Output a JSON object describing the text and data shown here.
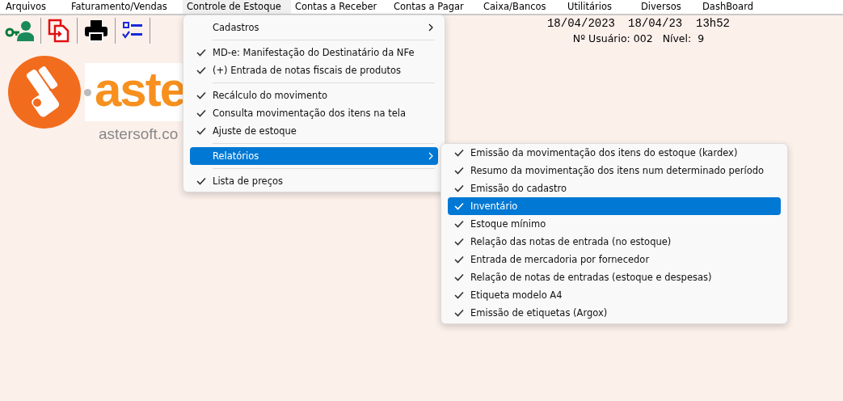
{
  "menu_bar": [
    {
      "label": "Arquivos",
      "selected": false
    },
    {
      "label": "Faturamento/Vendas",
      "selected": false
    },
    {
      "label": "Controle de Estoque",
      "selected": true
    },
    {
      "label": "Contas a Receber",
      "selected": false
    },
    {
      "label": "Contas a Pagar",
      "selected": false
    },
    {
      "label": "Caixa/Bancos",
      "selected": false
    },
    {
      "label": "Utilitários",
      "selected": false
    },
    {
      "label": "Diversos",
      "selected": false
    },
    {
      "label": "DashBoard",
      "selected": false
    }
  ],
  "toolbar": [
    {
      "kind": "user-key"
    },
    {
      "kind": "document-swap"
    },
    {
      "kind": "printer"
    },
    {
      "kind": "checklist"
    }
  ],
  "session": {
    "date": "18/04/2023",
    "datetime": "18/04/23  13h52",
    "user": "Nº Usuário: 002",
    "level": "Nível:  9"
  },
  "logo": {
    "wordmark": "aste",
    "website": "astersoft.co"
  },
  "menu": {
    "groups": [
      [
        {
          "label": "Cadastros",
          "checked": false,
          "selected": false,
          "submenu": true
        }
      ],
      [
        {
          "label": "MD-e: Manifestação do Destinatário da NFe",
          "checked": true,
          "selected": false,
          "submenu": false
        },
        {
          "label": "(+) Entrada de notas fiscais de produtos",
          "checked": true,
          "selected": false,
          "submenu": false
        }
      ],
      [
        {
          "label": "Recálculo do movimento",
          "checked": true,
          "selected": false,
          "submenu": false
        },
        {
          "label": "Consulta movimentação dos itens na tela",
          "checked": true,
          "selected": false,
          "submenu": false
        },
        {
          "label": "Ajuste de estoque",
          "checked": true,
          "selected": false,
          "submenu": false
        }
      ],
      [
        {
          "label": "Relatórios",
          "checked": false,
          "selected": true,
          "submenu": true
        }
      ],
      [
        {
          "label": "Lista de preços",
          "checked": true,
          "selected": false,
          "submenu": false
        }
      ]
    ]
  },
  "submenu": {
    "items": [
      {
        "label": "Emissão da movimentação dos itens do estoque (kardex)",
        "checked": true,
        "selected": false
      },
      {
        "label": "Resumo da movimentação dos itens num determinado período",
        "checked": true,
        "selected": false
      },
      {
        "label": "Emissão do cadastro",
        "checked": true,
        "selected": false
      },
      {
        "label": "Inventário",
        "checked": true,
        "selected": true
      },
      {
        "label": "Estoque mínimo",
        "checked": true,
        "selected": false
      },
      {
        "label": "Relação das notas de entrada (no estoque)",
        "checked": true,
        "selected": false
      },
      {
        "label": "Entrada de mercadoria por fornecedor",
        "checked": true,
        "selected": false
      },
      {
        "label": "Relação de notas de entradas (estoque e despesas)",
        "checked": true,
        "selected": false
      },
      {
        "label": "Etiqueta modelo A4",
        "checked": true,
        "selected": false
      },
      {
        "label": "Emissão de etiquetas (Argox)",
        "checked": true,
        "selected": false
      }
    ]
  }
}
